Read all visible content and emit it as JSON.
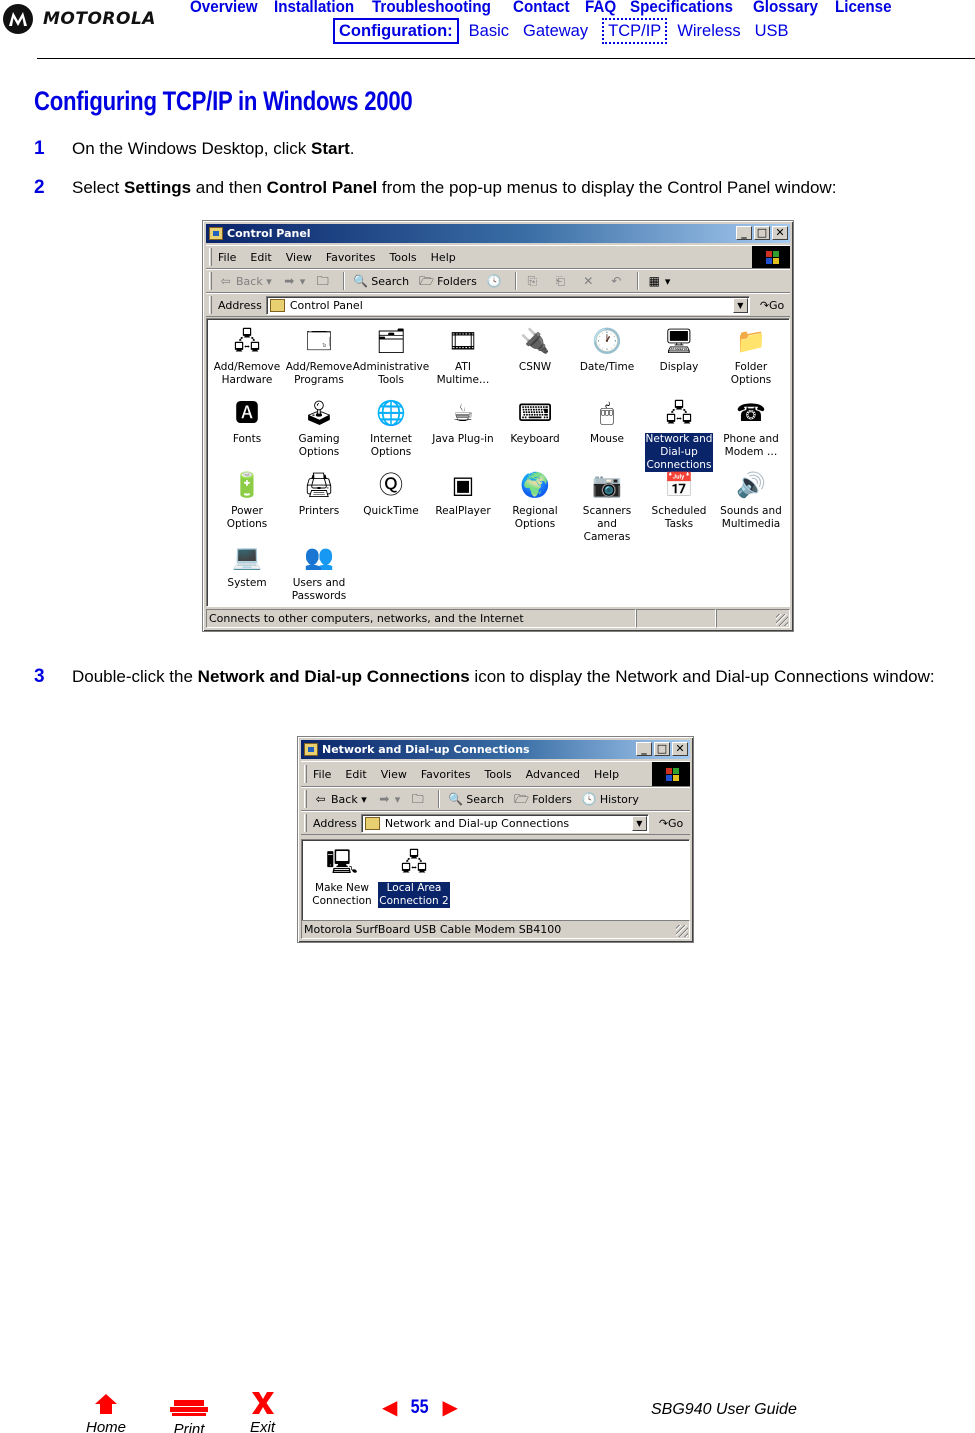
{
  "brand": {
    "name": "MOTOROLA"
  },
  "nav": {
    "primary": [
      "Overview",
      "Installation",
      "Troubleshooting",
      "Contact",
      "FAQ",
      "Specifications",
      "Glossary",
      "License"
    ],
    "config_label": "Configuration:",
    "secondary": [
      "Basic",
      "Gateway",
      "TCP/IP",
      "Wireless",
      "USB"
    ],
    "current": "TCP/IP"
  },
  "page": {
    "title": "Configuring TCP/IP in Windows 2000",
    "steps": [
      {
        "num": "1",
        "pre": "On the Windows Desktop, click ",
        "bold1": "Start",
        "mid": ".",
        "bold2": "",
        "post": ""
      },
      {
        "num": "2",
        "pre": "Select ",
        "bold1": "Settings",
        "mid": " and then ",
        "bold2": "Control Panel",
        "post": " from the pop-up menus to display the Control Panel window:"
      },
      {
        "num": "3",
        "pre": "Double-click the ",
        "bold1": "Network and Dial-up Connections",
        "mid": " icon to display the Network and Dial-up Connections window:",
        "bold2": "",
        "post": ""
      }
    ]
  },
  "control_panel": {
    "title": "Control Panel",
    "menu": [
      "File",
      "Edit",
      "View",
      "Favorites",
      "Tools",
      "Help"
    ],
    "toolbar": {
      "back": "Back",
      "search": "Search",
      "folders": "Folders"
    },
    "address_label": "Address",
    "address_value": "Control Panel",
    "go_label": "Go",
    "items": [
      {
        "label": "Add/Remove\nHardware",
        "icon": "hardware-icon",
        "glyph": "🖧",
        "selected": false
      },
      {
        "label": "Add/Remove\nPrograms",
        "icon": "programs-icon",
        "glyph": "🗔",
        "selected": false
      },
      {
        "label": "Administrative\nTools",
        "icon": "admin-tools-icon",
        "glyph": "🗂",
        "selected": false
      },
      {
        "label": "ATI\nMultime…",
        "icon": "ati-icon",
        "glyph": "🎞",
        "selected": false
      },
      {
        "label": "CSNW",
        "icon": "csnw-icon",
        "glyph": "🔌",
        "selected": false
      },
      {
        "label": "Date/Time",
        "icon": "clock-icon",
        "glyph": "🕐",
        "selected": false
      },
      {
        "label": "Display",
        "icon": "display-icon",
        "glyph": "🖥",
        "selected": false
      },
      {
        "label": "Folder\nOptions",
        "icon": "folder-options-icon",
        "glyph": "📁",
        "selected": false
      },
      {
        "label": "Fonts",
        "icon": "fonts-icon",
        "glyph": "🅰",
        "selected": false
      },
      {
        "label": "Gaming\nOptions",
        "icon": "joystick-icon",
        "glyph": "🕹",
        "selected": false
      },
      {
        "label": "Internet\nOptions",
        "icon": "internet-icon",
        "glyph": "🌐",
        "selected": false
      },
      {
        "label": "Java Plug-in",
        "icon": "java-icon",
        "glyph": "☕",
        "selected": false
      },
      {
        "label": "Keyboard",
        "icon": "keyboard-icon",
        "glyph": "⌨",
        "selected": false
      },
      {
        "label": "Mouse",
        "icon": "mouse-icon",
        "glyph": "🖱",
        "selected": false
      },
      {
        "label": "Network and\nDial-up\nConnections",
        "icon": "network-icon",
        "glyph": "🖧",
        "selected": true
      },
      {
        "label": "Phone and\nModem …",
        "icon": "phone-icon",
        "glyph": "☎",
        "selected": false
      },
      {
        "label": "Power\nOptions",
        "icon": "power-icon",
        "glyph": "🔋",
        "selected": false
      },
      {
        "label": "Printers",
        "icon": "printer-icon",
        "glyph": "🖨",
        "selected": false
      },
      {
        "label": "QuickTime",
        "icon": "quicktime-icon",
        "glyph": "Ⓠ",
        "selected": false
      },
      {
        "label": "RealPlayer",
        "icon": "realplayer-icon",
        "glyph": "▣",
        "selected": false
      },
      {
        "label": "Regional\nOptions",
        "icon": "globe-icon",
        "glyph": "🌍",
        "selected": false
      },
      {
        "label": "Scanners and\nCameras",
        "icon": "scanner-icon",
        "glyph": "📷",
        "selected": false
      },
      {
        "label": "Scheduled\nTasks",
        "icon": "scheduled-tasks-icon",
        "glyph": "📅",
        "selected": false
      },
      {
        "label": "Sounds and\nMultimedia",
        "icon": "speaker-icon",
        "glyph": "🔊",
        "selected": false
      },
      {
        "label": "System",
        "icon": "computer-icon",
        "glyph": "💻",
        "selected": false
      },
      {
        "label": "Users and\nPasswords",
        "icon": "users-icon",
        "glyph": "👥",
        "selected": false
      }
    ],
    "status": "Connects to other computers, networks, and the Internet"
  },
  "network_window": {
    "title": "Network and Dial-up Connections",
    "menu": [
      "File",
      "Edit",
      "View",
      "Favorites",
      "Tools",
      "Advanced",
      "Help"
    ],
    "toolbar": {
      "back": "Back",
      "search": "Search",
      "folders": "Folders",
      "history": "History"
    },
    "address_label": "Address",
    "address_value": "Network and Dial-up Connections",
    "go_label": "Go",
    "items": [
      {
        "label": "Make New\nConnection",
        "icon": "new-connection-icon",
        "glyph": "🖳",
        "selected": false
      },
      {
        "label": "Local Area\nConnection 2",
        "icon": "lan-icon",
        "glyph": "🖧",
        "selected": true
      }
    ],
    "status": "Motorola SurfBoard USB Cable Modem SB4100"
  },
  "footer": {
    "home": "Home",
    "print": "Print",
    "exit": "Exit",
    "page_number": "55",
    "guide_title": "SBG940 User Guide"
  }
}
